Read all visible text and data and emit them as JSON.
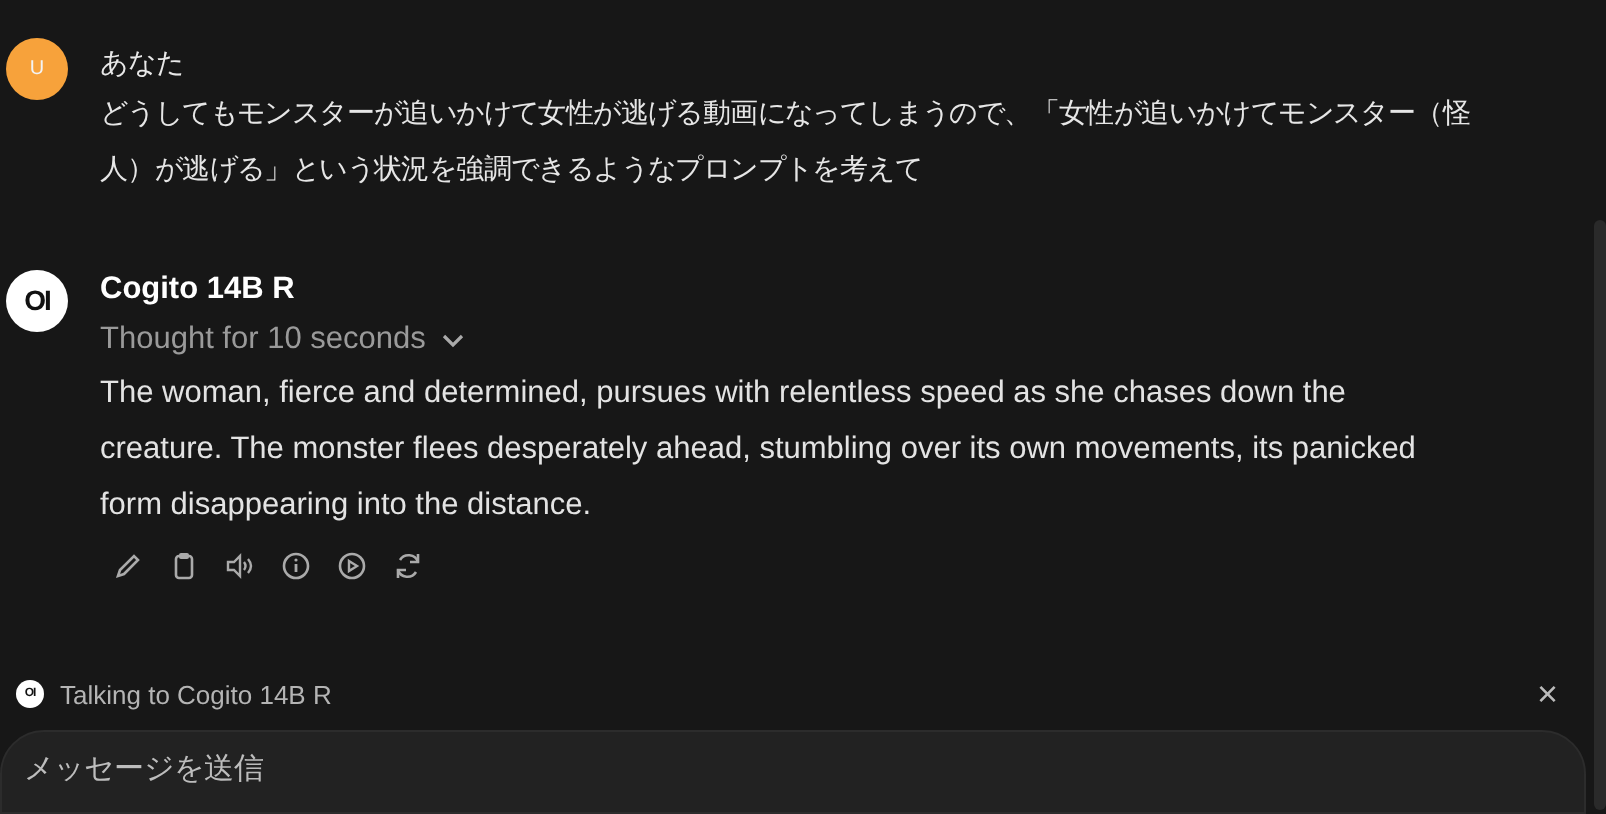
{
  "messages": [
    {
      "kind": "user",
      "avatar": "U",
      "sender": "あなた",
      "lines": [
        "どうしてもモンスターが追いかけて女性が逃げる動画になってしまうので、「女性が追いかけてモンスター（怪",
        "人）が逃げる」という状況を強調できるようなプロンプトを考えて"
      ]
    },
    {
      "kind": "assistant",
      "avatar": "OI",
      "sender": "Cogito 14B R",
      "thought": "Thought for 10 seconds",
      "lines": [
        "The woman, fierce and determined, pursues with relentless speed as she chases down the",
        "creature. The monster flees desperately ahead, stumbling over its own movements, its panicked",
        "form disappearing into the distance."
      ],
      "actions": [
        {
          "kind": "edit"
        },
        {
          "kind": "copy"
        },
        {
          "kind": "speak"
        },
        {
          "kind": "info"
        },
        {
          "kind": "continue"
        },
        {
          "kind": "regenerate"
        }
      ]
    }
  ],
  "composer": {
    "logo": "OI",
    "talking_to": "Talking to Cogito 14B R",
    "close": "×",
    "placeholder": "メッセージを送信"
  }
}
